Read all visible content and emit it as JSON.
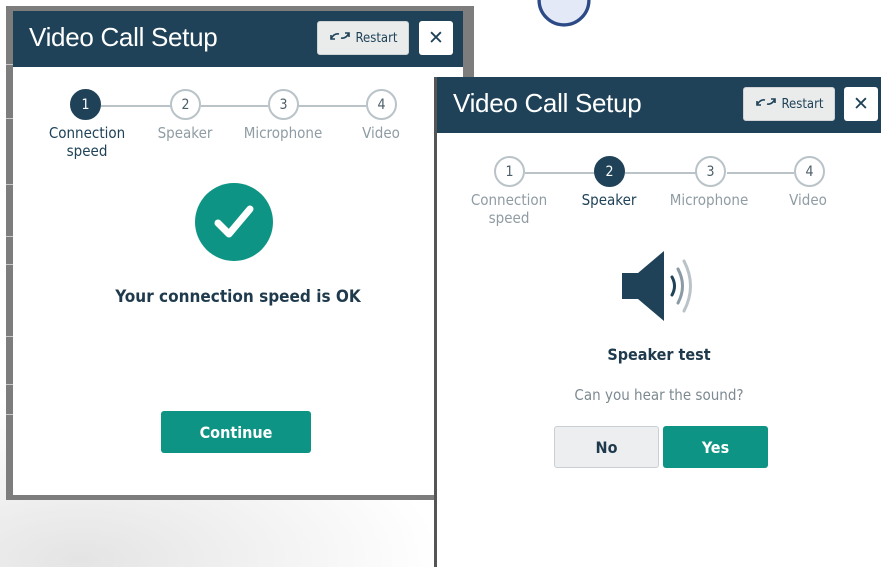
{
  "colors": {
    "header": "#1f4258",
    "accent": "#0e9484",
    "step_inactive": "#b9c3c8"
  },
  "modal_1": {
    "title": "Video Call Setup",
    "restart_label": "Restart",
    "restart_icon": "refresh-icon",
    "close_icon": "close-icon",
    "steps": [
      {
        "number": "1",
        "label_line1": "Connection",
        "label_line2": "speed",
        "active": true
      },
      {
        "number": "2",
        "label_line1": "Speaker",
        "label_line2": "",
        "active": false
      },
      {
        "number": "3",
        "label_line1": "Microphone",
        "label_line2": "",
        "active": false
      },
      {
        "number": "4",
        "label_line1": "Video",
        "label_line2": "",
        "active": false
      }
    ],
    "status_icon": "checkmark-icon",
    "message": "Your connection speed is OK",
    "continue_label": "Continue"
  },
  "modal_2": {
    "title": "Video Call Setup",
    "restart_label": "Restart",
    "restart_icon": "refresh-icon",
    "close_icon": "close-icon",
    "steps": [
      {
        "number": "1",
        "label_line1": "Connection",
        "label_line2": "speed",
        "active": false
      },
      {
        "number": "2",
        "label_line1": "Speaker",
        "label_line2": "",
        "active": true
      },
      {
        "number": "3",
        "label_line1": "Microphone",
        "label_line2": "",
        "active": false
      },
      {
        "number": "4",
        "label_line1": "Video",
        "label_line2": "",
        "active": false
      }
    ],
    "status_icon": "speaker-icon",
    "heading": "Speaker test",
    "question": "Can you hear the sound?",
    "no_label": "No",
    "yes_label": "Yes"
  }
}
